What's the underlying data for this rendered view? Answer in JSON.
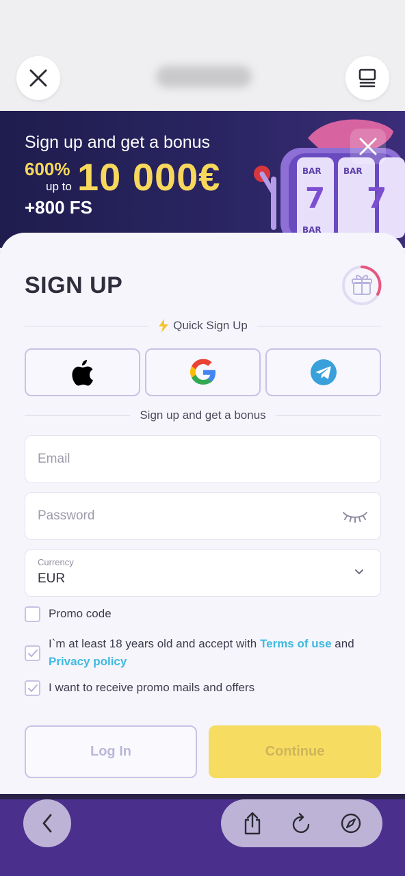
{
  "browser": {
    "url_text": "",
    "close_icon": "close-icon",
    "tabs_icon": "tabs-icon"
  },
  "banner": {
    "title": "Sign up and get a bonus",
    "percent": "600%",
    "up_to": "up to",
    "amount": "10 000€",
    "free_spins": "+800 FS",
    "accent_color": "#f7d85c"
  },
  "form": {
    "title": "SIGN UP",
    "quick_signup": "Quick Sign Up",
    "social": [
      "apple",
      "google",
      "telegram"
    ],
    "bonus_divider": "Sign up and get a bonus",
    "email_placeholder": "Email",
    "password_placeholder": "Password",
    "currency_label": "Currency",
    "currency_value": "EUR",
    "promo_label": "Promo code",
    "age_text_1": "I`m at least 18 years old and accept with ",
    "terms_link": "Terms of use",
    "age_text_and": " and",
    "privacy_link": "Privacy policy",
    "mails_text": "I want to receive promo mails and offers",
    "promo_checked": false,
    "age_checked": true,
    "mails_checked": true,
    "login_button": "Log In",
    "continue_button": "Continue"
  },
  "toolbar": {
    "icons": [
      "back-icon",
      "share-icon",
      "reload-icon",
      "compass-icon"
    ]
  }
}
